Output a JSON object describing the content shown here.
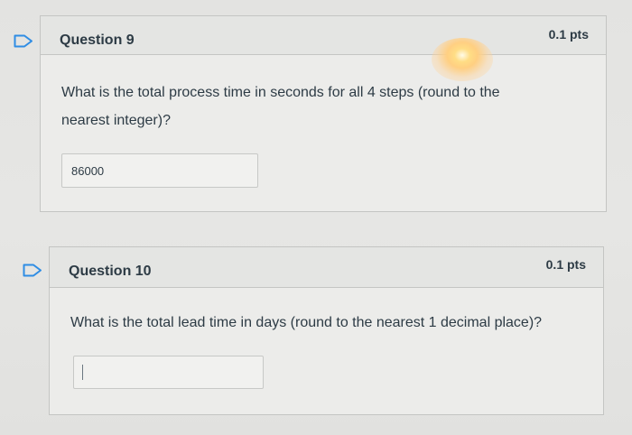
{
  "questions": [
    {
      "title": "Question 9",
      "points": "0.1 pts",
      "text_line1": "What is the total process time in seconds for all 4 steps (round to the",
      "text_line2": "nearest integer)?",
      "answer_value": "86000"
    },
    {
      "title": "Question 10",
      "points": "0.1 pts",
      "text": "What is the total lead time in days (round to the nearest 1 decimal place)?",
      "answer_value": ""
    }
  ],
  "icons": {
    "flag": "flag-outline-icon"
  },
  "colors": {
    "flag": "#2f8de4",
    "text": "#2d3b45"
  }
}
